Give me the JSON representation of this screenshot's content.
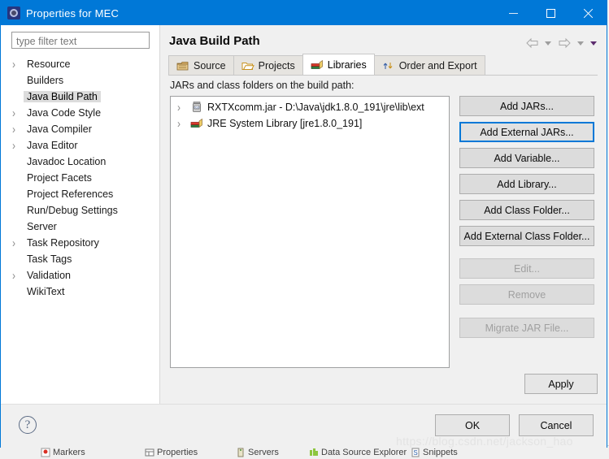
{
  "window": {
    "title": "Properties for MEC",
    "icon": "properties-gear-icon",
    "minimize_label": "Minimize",
    "maximize_label": "Maximize",
    "close_label": "Close"
  },
  "sidebar": {
    "filter_placeholder": "type filter text",
    "filter_value": "",
    "items": [
      {
        "label": "Resource",
        "expandable": true,
        "selected": false
      },
      {
        "label": "Builders",
        "expandable": false,
        "selected": false
      },
      {
        "label": "Java Build Path",
        "expandable": false,
        "selected": true
      },
      {
        "label": "Java Code Style",
        "expandable": true,
        "selected": false
      },
      {
        "label": "Java Compiler",
        "expandable": true,
        "selected": false
      },
      {
        "label": "Java Editor",
        "expandable": true,
        "selected": false
      },
      {
        "label": "Javadoc Location",
        "expandable": false,
        "selected": false
      },
      {
        "label": "Project Facets",
        "expandable": false,
        "selected": false
      },
      {
        "label": "Project References",
        "expandable": false,
        "selected": false
      },
      {
        "label": "Run/Debug Settings",
        "expandable": false,
        "selected": false
      },
      {
        "label": "Server",
        "expandable": false,
        "selected": false
      },
      {
        "label": "Task Repository",
        "expandable": true,
        "selected": false
      },
      {
        "label": "Task Tags",
        "expandable": false,
        "selected": false
      },
      {
        "label": "Validation",
        "expandable": true,
        "selected": false
      },
      {
        "label": "WikiText",
        "expandable": false,
        "selected": false
      }
    ]
  },
  "page": {
    "title": "Java Build Path",
    "nav": {
      "back_label": "Back",
      "back_menu_label": "Back history",
      "forward_label": "Forward",
      "forward_menu_label": "Forward history",
      "view_menu_label": "View menu"
    },
    "tabs": [
      {
        "label": "Source",
        "icon": "source-folder-icon",
        "active": false
      },
      {
        "label": "Projects",
        "icon": "open-folder-icon",
        "active": false
      },
      {
        "label": "Libraries",
        "icon": "library-books-icon",
        "active": true
      },
      {
        "label": "Order and Export",
        "icon": "order-arrows-icon",
        "active": false
      }
    ],
    "libraries": {
      "list_label": "JARs and class folders on the build path:",
      "entries": [
        {
          "label": "RXTXcomm.jar - D:\\Java\\jdk1.8.0_191\\jre\\lib\\ext",
          "icon": "jar-icon",
          "expandable": true
        },
        {
          "label": "JRE System Library [jre1.8.0_191]",
          "icon": "library-books-icon",
          "expandable": true
        }
      ],
      "buttons": [
        {
          "label": "Add JARs...",
          "state": "enabled"
        },
        {
          "label": "Add External JARs...",
          "state": "focused"
        },
        {
          "label": "Add Variable...",
          "state": "enabled"
        },
        {
          "label": "Add Library...",
          "state": "enabled"
        },
        {
          "label": "Add Class Folder...",
          "state": "enabled"
        },
        {
          "label": "Add External Class Folder...",
          "state": "enabled"
        },
        {
          "label": "Edit...",
          "state": "disabled"
        },
        {
          "label": "Remove",
          "state": "disabled"
        },
        {
          "label": "Migrate JAR File...",
          "state": "disabled"
        }
      ]
    },
    "apply_label": "Apply"
  },
  "footer": {
    "help_glyph": "?",
    "ok_label": "OK",
    "cancel_label": "Cancel"
  },
  "watermark": "https://blog.csdn.net/jackson_hao",
  "background_tabs": [
    {
      "label": "Markers",
      "icon": "markers-icon"
    },
    {
      "label": "Properties",
      "icon": "properties-icon"
    },
    {
      "label": "Servers",
      "icon": "servers-icon"
    },
    {
      "label": "Data Source Explorer",
      "icon": "datasource-icon"
    },
    {
      "label": "Snippets",
      "icon": "snippets-icon"
    }
  ],
  "colors": {
    "titlebar": "#0078d7",
    "focus_border": "#0078d7",
    "selection": "#dcdcdc",
    "dialog_bg": "#f0f0f0"
  }
}
